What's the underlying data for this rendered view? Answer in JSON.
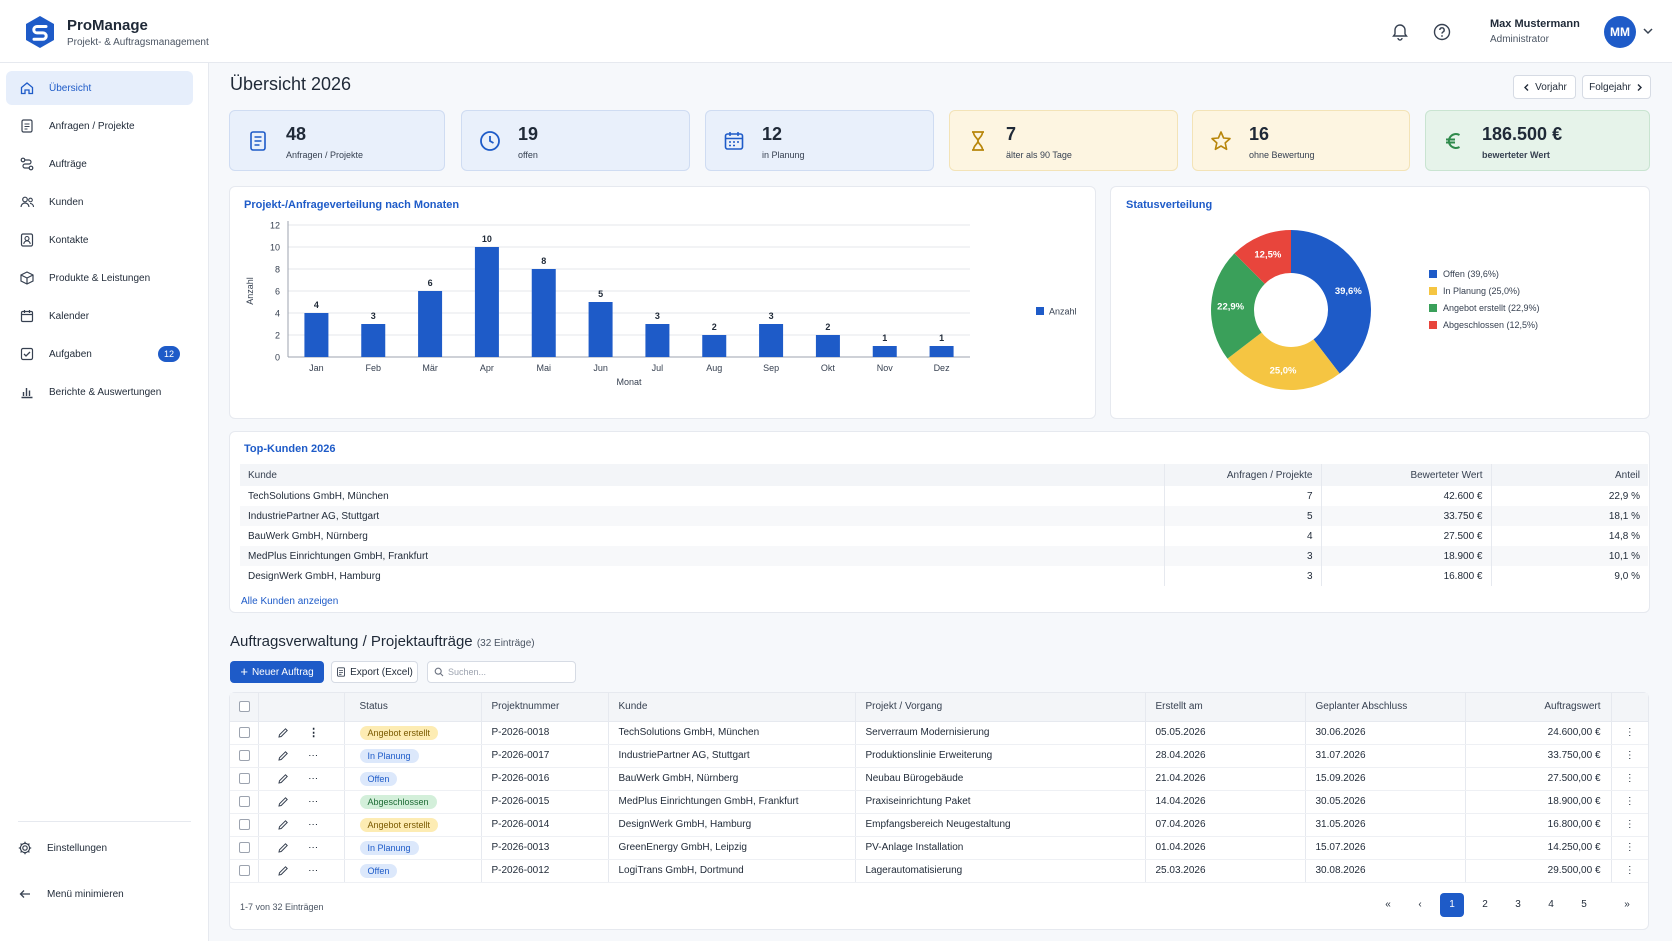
{
  "app": {
    "name": "ProManage",
    "subtitle": "Projekt- & Auftragsmanagement"
  },
  "header": {
    "user_name": "Max Mustermann",
    "user_role": "Administrator",
    "avatar_initials": "MM",
    "icons": [
      "bell-icon",
      "help-icon",
      "chevron-down-icon"
    ]
  },
  "sidebar": {
    "items": [
      {
        "label": "Übersicht",
        "icon": "home-icon",
        "active": true
      },
      {
        "label": "Anfragen / Projekte",
        "icon": "document-icon"
      },
      {
        "label": "Aufträge",
        "icon": "workflow-icon"
      },
      {
        "label": "Kunden",
        "icon": "users-icon"
      },
      {
        "label": "Kontakte",
        "icon": "contact-icon"
      },
      {
        "label": "Produkte & Leistungen",
        "icon": "box-icon"
      },
      {
        "label": "Kalender",
        "icon": "calendar-icon"
      },
      {
        "label": "Aufgaben",
        "icon": "task-icon",
        "badge": "12"
      },
      {
        "label": "Berichte & Auswertungen",
        "icon": "report-icon"
      }
    ],
    "settings_label": "Einstellungen",
    "minimize_label": "Menü minimieren"
  },
  "page": {
    "title": "Übersicht 2026",
    "prev_year": "Vorjahr",
    "next_year": "Folgejahr"
  },
  "kpis": [
    {
      "value": "48",
      "label": "Anfragen / Projekte",
      "icon": "document-icon"
    },
    {
      "value": "19",
      "label": "offen",
      "icon": "clock-icon"
    },
    {
      "value": "12",
      "label": "in Planung",
      "icon": "calendar-icon"
    },
    {
      "value": "7",
      "label": "älter als 90 Tage",
      "icon": "hourglass-icon"
    },
    {
      "value": "16",
      "label": "ohne Bewertung",
      "icon": "star-icon"
    },
    {
      "value": "186.500 €",
      "label": "bewerteter Wert",
      "icon": "euro-icon"
    }
  ],
  "colors": {
    "primary": "#1e5bc8",
    "yellow": "#f5c542",
    "green": "#3aa05a",
    "red": "#e8453c"
  },
  "bar_panel_title": "Projekt-/Anfrageverteilung nach Monaten",
  "pie_panel_title": "Statusverteilung",
  "chart_data": [
    {
      "type": "bar",
      "title": "Projekt-/Anfrageverteilung nach Monaten",
      "xlabel": "Monat",
      "ylabel": "Anzahl",
      "categories": [
        "Jan",
        "Feb",
        "Mär",
        "Apr",
        "Mai",
        "Jun",
        "Jul",
        "Aug",
        "Sep",
        "Okt",
        "Nov",
        "Dez"
      ],
      "series": [
        {
          "name": "Anzahl",
          "values": [
            4,
            3,
            6,
            10,
            8,
            5,
            3,
            2,
            3,
            2,
            1,
            1
          ]
        }
      ],
      "ylim": [
        0,
        12
      ],
      "yticks": [
        0,
        2,
        4,
        6,
        8,
        10,
        12
      ],
      "grid": true,
      "legend": "right"
    },
    {
      "type": "pie",
      "title": "Statusverteilung",
      "slices": [
        {
          "label": "Offen (39,6%)",
          "value": 39.6,
          "pct_label": "39,6%",
          "color": "#1e5bc8"
        },
        {
          "label": "In Planung (25,0%)",
          "value": 25.0,
          "pct_label": "25,0%",
          "color": "#f5c542"
        },
        {
          "label": "Angebot erstellt (22,9%)",
          "value": 22.9,
          "pct_label": "22,9%",
          "color": "#3aa05a"
        },
        {
          "label": "Abgeschlossen (12,5%)",
          "value": 12.5,
          "pct_label": "12,5%",
          "color": "#e8453c"
        }
      ],
      "donut": true,
      "legend": "right"
    }
  ],
  "top_customers": {
    "title": "Top-Kunden 2026",
    "columns": [
      "Kunde",
      "Anfragen / Projekte",
      "Bewerteter Wert",
      "Anteil"
    ],
    "rows": [
      [
        "TechSolutions GmbH, München",
        "7",
        "42.600 €",
        "22,9 %"
      ],
      [
        "IndustriePartner AG, Stuttgart",
        "5",
        "33.750 €",
        "18,1 %"
      ],
      [
        "BauWerk GmbH, Nürnberg",
        "4",
        "27.500 €",
        "14,8 %"
      ],
      [
        "MedPlus Einrichtungen GmbH, Frankfurt",
        "3",
        "18.900 €",
        "10,1 %"
      ],
      [
        "DesignWerk GmbH, Hamburg",
        "3",
        "16.800 €",
        "9,0 %"
      ]
    ],
    "show_all": "Alle Kunden anzeigen"
  },
  "orders": {
    "title": "Auftragsverwaltung / Projektaufträge",
    "count": "(32 Einträge)",
    "new_button": "Neuer Auftrag",
    "export_button": "Export (Excel)",
    "search_placeholder": "Suchen...",
    "columns": [
      "Status",
      "Projektnummer",
      "Kunde",
      "Projekt / Vorgang",
      "Erstellt am",
      "Geplanter Abschluss",
      "Auftragswert"
    ],
    "rows": [
      {
        "status": "Angebot erstellt",
        "tone": "yellow",
        "nr": "P-2026-0018",
        "kunde": "TechSolutions GmbH, München",
        "projekt": "Serverraum Modernisierung",
        "erstellt": "05.05.2026",
        "abschluss": "30.06.2026",
        "wert": "24.600,00 €"
      },
      {
        "status": "In Planung",
        "tone": "blue",
        "nr": "P-2026-0017",
        "kunde": "IndustriePartner AG, Stuttgart",
        "projekt": "Produktionslinie Erweiterung",
        "erstellt": "28.04.2026",
        "abschluss": "31.07.2026",
        "wert": "33.750,00 €"
      },
      {
        "status": "Offen",
        "tone": "blue",
        "nr": "P-2026-0016",
        "kunde": "BauWerk GmbH, Nürnberg",
        "projekt": "Neubau Bürogebäude",
        "erstellt": "21.04.2026",
        "abschluss": "15.09.2026",
        "wert": "27.500,00 €"
      },
      {
        "status": "Abgeschlossen",
        "tone": "green",
        "nr": "P-2026-0015",
        "kunde": "MedPlus Einrichtungen GmbH, Frankfurt",
        "projekt": "Praxiseinrichtung Paket",
        "erstellt": "14.04.2026",
        "abschluss": "30.05.2026",
        "wert": "18.900,00 €"
      },
      {
        "status": "Angebot erstellt",
        "tone": "yellow",
        "nr": "P-2026-0014",
        "kunde": "DesignWerk GmbH, Hamburg",
        "projekt": "Empfangsbereich Neugestaltung",
        "erstellt": "07.04.2026",
        "abschluss": "31.05.2026",
        "wert": "16.800,00 €"
      },
      {
        "status": "In Planung",
        "tone": "blue",
        "nr": "P-2026-0013",
        "kunde": "GreenEnergy GmbH, Leipzig",
        "projekt": "PV-Anlage Installation",
        "erstellt": "01.04.2026",
        "abschluss": "15.07.2026",
        "wert": "14.250,00 €"
      },
      {
        "status": "Offen",
        "tone": "blue",
        "nr": "P-2026-0012",
        "kunde": "LogiTrans GmbH, Dortmund",
        "projekt": "Lagerautomatisierung",
        "erstellt": "25.03.2026",
        "abschluss": "30.08.2026",
        "wert": "29.500,00 €"
      }
    ],
    "pager_info": "1-7 von 32 Einträgen",
    "pages": [
      "1",
      "2",
      "3",
      "4",
      "5"
    ],
    "current_page": "1"
  }
}
